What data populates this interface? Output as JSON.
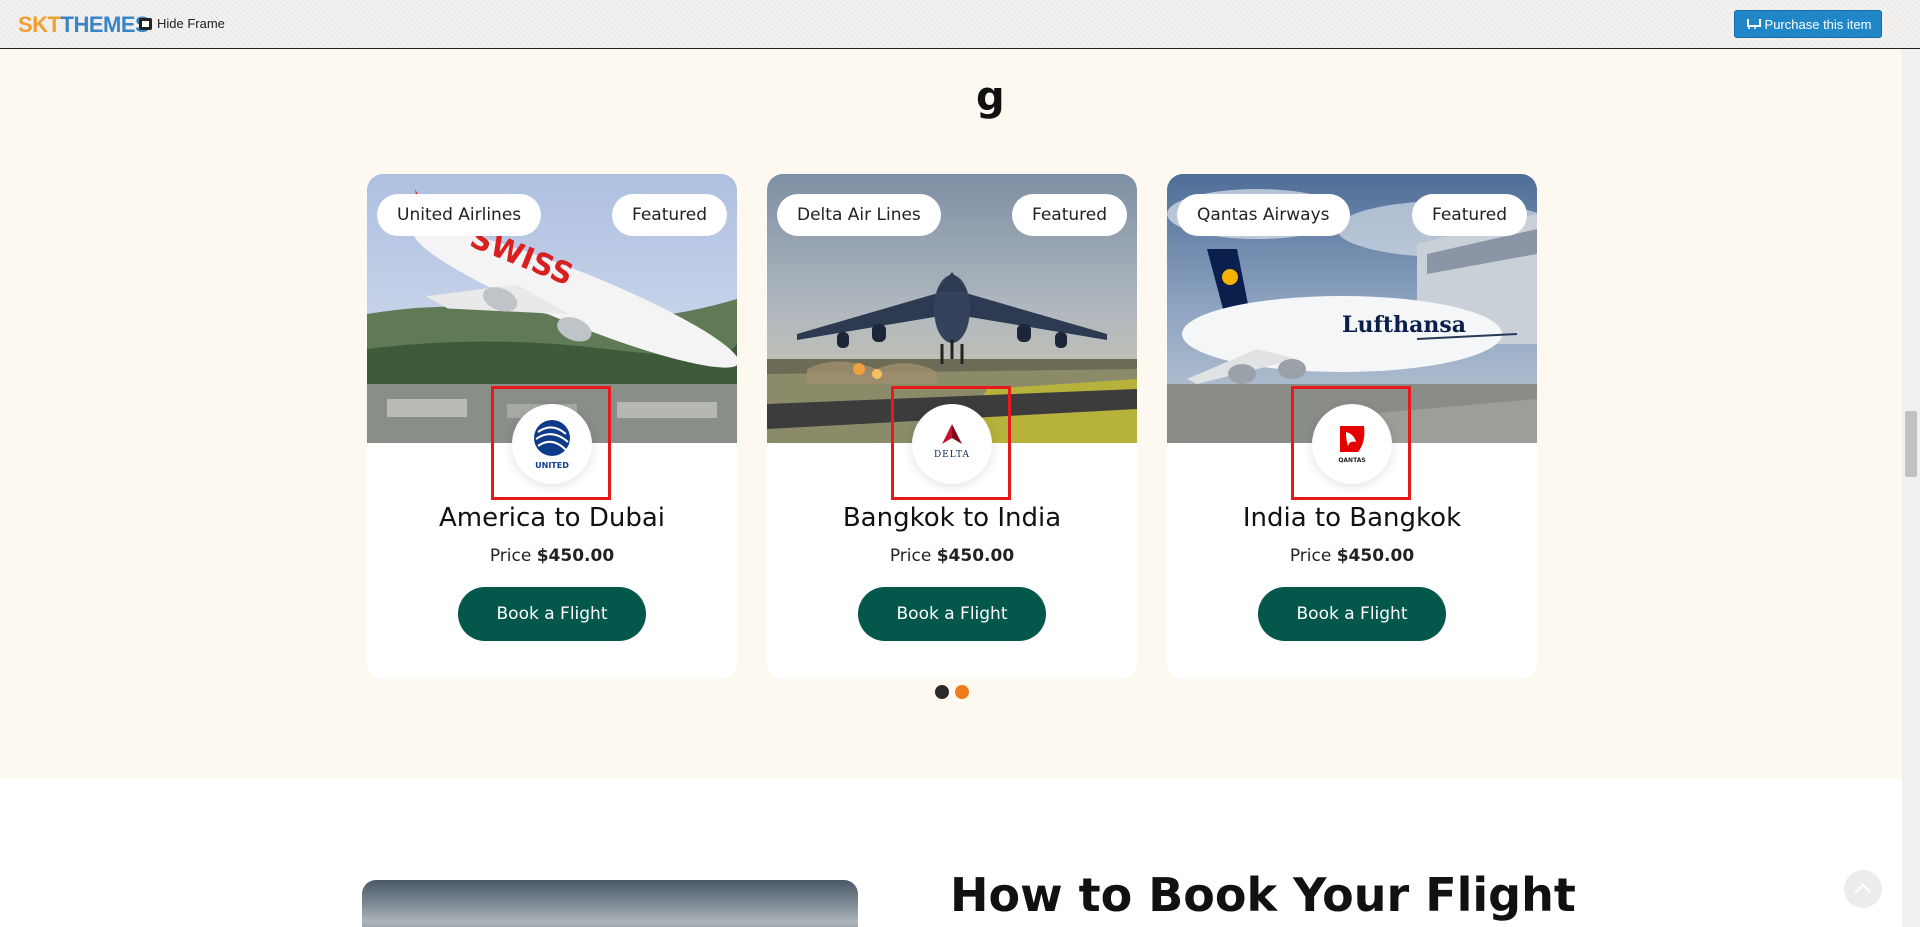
{
  "topbar": {
    "logo_sct": "SKT",
    "logo_themes": "THEMES",
    "hide_frame_label": "Hide Frame",
    "purchase_label": "Purchase this item"
  },
  "section": {
    "title_fragment": "g"
  },
  "cards": [
    {
      "airline": "United Airlines",
      "badge": "Featured",
      "logo_text": "UNITED",
      "route": "America to Dubai",
      "price_label": "Price",
      "price_value": "$450.00",
      "button_label": "Book a Flight"
    },
    {
      "airline": "Delta Air Lines",
      "badge": "Featured",
      "logo_text": "DELTA",
      "route": "Bangkok to India",
      "price_label": "Price",
      "price_value": "$450.00",
      "button_label": "Book a Flight"
    },
    {
      "airline": "Qantas Airways",
      "badge": "Featured",
      "logo_text": "QANTAS",
      "route": "India to Bangkok",
      "price_label": "Price",
      "price_value": "$450.00",
      "button_label": "Book a Flight"
    }
  ],
  "carousel": {
    "pages": 2,
    "active_page": 2
  },
  "how_to": {
    "title": "How to Book Your Flight"
  },
  "colors": {
    "accent_green": "#04574b",
    "accent_orange": "#f07d1c",
    "highlight_red": "#e8191a",
    "section_bg": "#fdf9f0"
  },
  "icons": [
    "cart-icon",
    "frame-icon",
    "united-globe-logo",
    "delta-widget-logo",
    "qantas-kangaroo-logo",
    "chevron-up-icon"
  ]
}
